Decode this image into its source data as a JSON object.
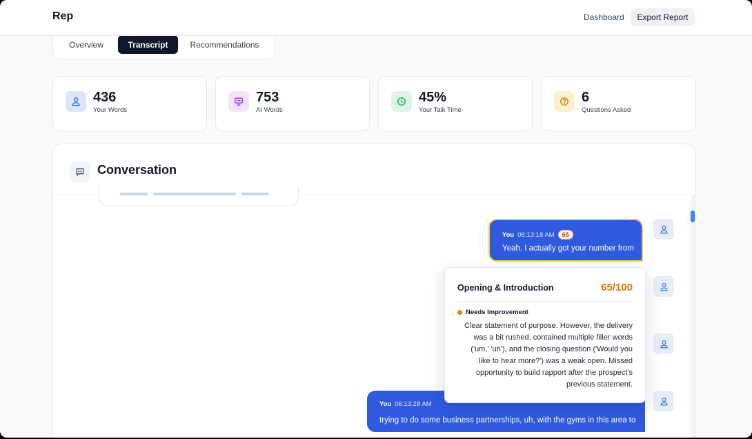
{
  "header": {
    "brand": "Rep",
    "dashboard_label": "Dashboard",
    "export_label": "Export Report"
  },
  "tabs": [
    {
      "label": "Overview"
    },
    {
      "label": "Transcript"
    },
    {
      "label": "Recommendations"
    }
  ],
  "stats": [
    {
      "value": "436",
      "label": "Your Words",
      "icon": "user-icon",
      "color": "#2563eb",
      "bg": "#dbe6fb"
    },
    {
      "value": "753",
      "label": "AI Words",
      "icon": "monitor-icon",
      "color": "#9333ea",
      "bg": "#f3e3fc"
    },
    {
      "value": "45%",
      "label": "Your Talk Time",
      "icon": "clock-icon",
      "color": "#16a34a",
      "bg": "#dcf5e5"
    },
    {
      "value": "6",
      "label": "Questions Asked",
      "icon": "question-icon",
      "color": "#d97706",
      "bg": "#fdf0d0"
    }
  ],
  "conversation": {
    "title": "Conversation",
    "messages": [
      {
        "speaker": "You",
        "time": "06:13:18 AM",
        "score": "65",
        "text": "Yeah. I actually got your number from"
      },
      {
        "speaker": "You",
        "time": "06:13:28 AM",
        "text": "trying to do some business partnerships, uh, with the gyms in this area to"
      }
    ]
  },
  "popup": {
    "title": "Opening & Introduction",
    "score": "65/100",
    "status": "Needs Improvement",
    "body": "Clear statement of purpose. However, the delivery was a bit rushed, contained multiple filler words ('um,' 'uh'), and the closing question ('Would you like to hear more?') was a weak open. Missed opportunity to build rapport after the prospect's previous statement."
  },
  "colors": {
    "accent": "#2f5ae0",
    "highlight": "#f2c94c",
    "warning": "#d97706"
  }
}
